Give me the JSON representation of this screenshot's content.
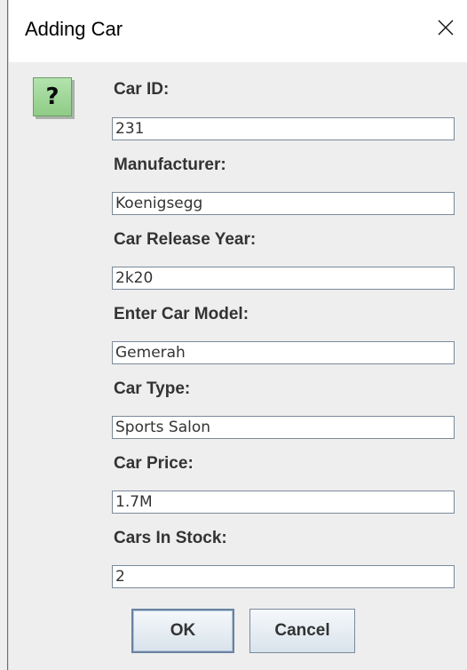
{
  "dialog": {
    "title": "Adding Car",
    "close_icon": "close-icon",
    "question_icon": "question-icon",
    "question_glyph": "?"
  },
  "fields": [
    {
      "label": "Car ID:",
      "value": "231"
    },
    {
      "label": "Manufacturer:",
      "value": "Koenigsegg"
    },
    {
      "label": "Car Release Year:",
      "value": "2k20"
    },
    {
      "label": "Enter Car Model:",
      "value": "Gemerah"
    },
    {
      "label": "Car Type:",
      "value": "Sports Salon"
    },
    {
      "label": "Car Price:",
      "value": "1.7M"
    },
    {
      "label": "Cars In Stock:",
      "value": "2"
    }
  ],
  "buttons": {
    "ok_label": "OK",
    "cancel_label": "Cancel"
  },
  "colors": {
    "icon_green": "#9fd898",
    "button_border_focus": "#6a82a0",
    "window_background": "#eeeeee"
  }
}
